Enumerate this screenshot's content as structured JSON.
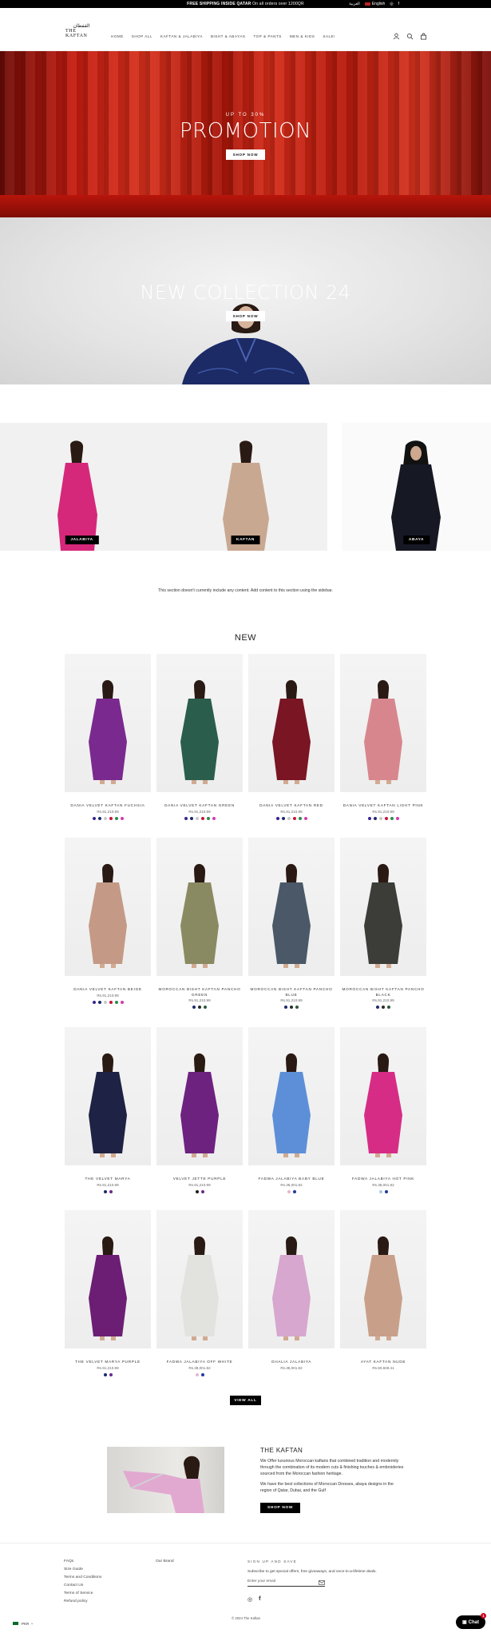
{
  "announcement": {
    "text_bold": "FREE SHIPPING INSIDE QATAR",
    "text_rest": " On all orders over 1200QR",
    "lang_ar": "العربية",
    "lang_en": "English"
  },
  "header": {
    "logo_ar": "القفطان",
    "logo_en": "THE KAFTAN",
    "nav": [
      "HOME",
      "SHOP ALL",
      "KAFTAN & JALABIYA",
      "BISHT & ABAYAS",
      "TOP & PANTS",
      "MEN & KIDS",
      "SALE!"
    ],
    "icons": [
      "account-icon",
      "search-icon",
      "cart-icon"
    ]
  },
  "hero": {
    "promo_kicker": "UP TO 30%",
    "promo_title": "PROMOTION",
    "promo_button": "SHOP NOW",
    "collection_title": "NEW COLLECTION 24",
    "collection_button": "SHOP NOW"
  },
  "categories": [
    {
      "label": "JALABIYA",
      "color": "#d6287a"
    },
    {
      "label": "KAFTAN",
      "color": "#c9a891"
    },
    {
      "label": "ABAYA",
      "color": "#161824"
    }
  ],
  "empty_notice": "This section doesn't currently include any content. Add content to this section using the sidebar.",
  "products_title": "NEW",
  "products": [
    {
      "name": "DANIA VELVET KAFTAN FUCHSIA",
      "price": "Rs.91,210.99",
      "dress": "#7a2a8e",
      "swatches": [
        "#3a2590",
        "#1c2a6a",
        "#c9c9c9",
        "#c8143c",
        "#2e8a4c",
        "#d43ab0"
      ]
    },
    {
      "name": "DANIA VELVET KAFTAN GREEN",
      "price": "Rs.91,210.99",
      "dress": "#2b5d4c",
      "swatches": [
        "#3a2590",
        "#1c2a6a",
        "#c9c9c9",
        "#c8143c",
        "#2e8a4c",
        "#d43ab0"
      ]
    },
    {
      "name": "DANIA VELVET KAFTAN RED",
      "price": "Rs.91,210.99",
      "dress": "#7a1524",
      "swatches": [
        "#3a2590",
        "#1c2a6a",
        "#c9c9c9",
        "#c8143c",
        "#2e8a4c",
        "#d43ab0"
      ]
    },
    {
      "name": "DANIA VELVET KAFTAN LIGHT PINK",
      "price": "Rs.91,210.99",
      "dress": "#d8868e",
      "swatches": [
        "#3a2590",
        "#1c2a6a",
        "#c9c9c9",
        "#c8143c",
        "#2e8a4c",
        "#d43ab0"
      ]
    },
    {
      "name": "DANIA VELVET KAFTAN BEIGE",
      "price": "Rs.91,210.99",
      "dress": "#c49a86",
      "swatches": [
        "#3a2590",
        "#1c2a6a",
        "#c9c9c9",
        "#c8143c",
        "#2e8a4c",
        "#d43ab0"
      ]
    },
    {
      "name": "MOROCCAN BISHT KAFTAN PANCHO GREEN",
      "price": "Rs.91,210.99",
      "dress": "#8a8a62",
      "swatches": [
        "#1c2a6a",
        "#2a2a2a",
        "#2e5a3c"
      ]
    },
    {
      "name": "MOROCCAN BISHT KAFTAN PANCHO BLUE",
      "price": "Rs.91,210.99",
      "dress": "#4a5868",
      "swatches": [
        "#1c2a6a",
        "#2a2a2a",
        "#2e5a3c"
      ]
    },
    {
      "name": "MOROCCAN BISHT KAFTAN PANCHO BLACK",
      "price": "Rs.91,210.99",
      "dress": "#3c3c38",
      "swatches": [
        "#1c2a6a",
        "#2a2a2a",
        "#2e5a3c"
      ]
    },
    {
      "name": "THE VELVET MARYA",
      "price": "Rs.91,210.99",
      "dress": "#1e2244",
      "swatches": [
        "#1c2a6a",
        "#6a2a8a"
      ]
    },
    {
      "name": "VELVET JETTE PURPLE",
      "price": "Rs.91,210.99",
      "dress": "#6e2280",
      "swatches": [
        "#1c1c1c",
        "#6a2a8a"
      ]
    },
    {
      "name": "FADWA JALABIYA BABY BLUE",
      "price": "Rs.38,001.82",
      "dress": "#5d8fd8",
      "swatches": [
        "#e4b6cf",
        "#2238a0"
      ]
    },
    {
      "name": "FADWA JALABIYA HOT PINK",
      "price": "Rs.38,001.82",
      "dress": "#d62c86",
      "swatches": [
        "#a8c8e8",
        "#2238a0"
      ]
    },
    {
      "name": "THE VELVET MARYA PURPLE",
      "price": "Rs.91,210.99",
      "dress": "#6c1e74",
      "swatches": [
        "#1c2a6a",
        "#6a2a8a"
      ]
    },
    {
      "name": "FADWA JALABIYA OFF WHITE",
      "price": "Rs.38,001.82",
      "dress": "#e2e2de",
      "swatches": [
        "#e4b6cf",
        "#2238a0"
      ]
    },
    {
      "name": "GHALIA JALABIYA",
      "price": "Rs.38,001.82",
      "dress": "#d7a7cf",
      "swatches": []
    },
    {
      "name": "AYAT KAFTAN NUDE",
      "price": "Rs.60,848.41",
      "dress": "#c8a08a",
      "swatches": []
    }
  ],
  "view_all": "VIEW ALL",
  "about": {
    "title": "THE KAFTAN",
    "p1": "We Offer luxurious Moroccan kaftans that combined tradition and modernity through the combination of its modern cuts & finishing touches & embroideries sourced from the Moroccan fashion heritage.",
    "p2": "We have the best collections of Moroccan Dresses, abaya designs in the region of Qatar, Dubai, and the Gulf",
    "button": "SHOP NOW"
  },
  "footer": {
    "col1": [
      "FAQs",
      "Size Guide",
      "Terms and Conditions",
      "Contact Us",
      "Terms of Service",
      "Refund policy"
    ],
    "col2": [
      "Our Brand"
    ],
    "newsletter_title": "SIGN UP AND SAVE",
    "newsletter_desc": "Subscribe to get special offers, free giveaways, and once-in-a-lifetime deals.",
    "email_placeholder": "Enter your email",
    "copyright": "© 2024 The Kaftan",
    "currency": "PKR",
    "chat": "Chat",
    "chat_badge": "1"
  },
  "colors": {
    "accent": "#000000",
    "promo_red": "#c51c10"
  }
}
